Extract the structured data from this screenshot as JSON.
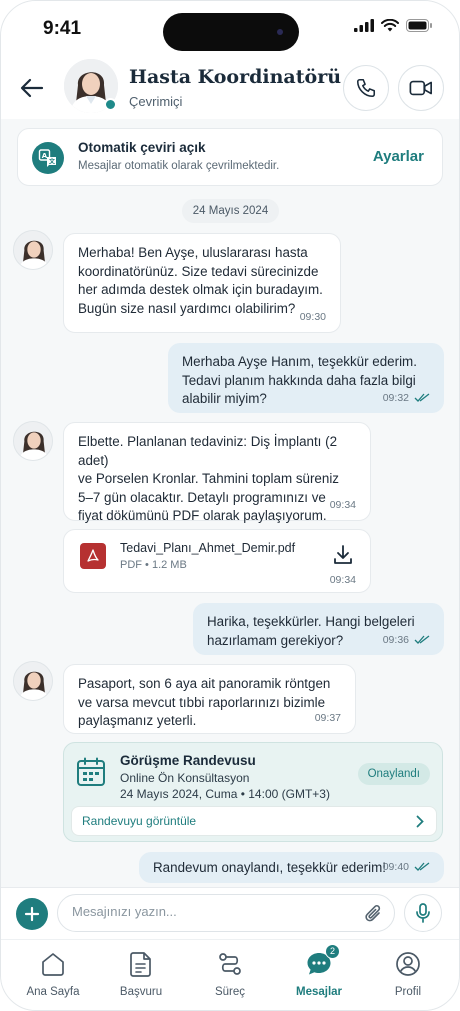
{
  "status_bar": {
    "time": "9:41"
  },
  "header": {
    "title": "Hasta Koordinatörü",
    "status": "Çevrimiçi",
    "icons": [
      "back-arrow-icon",
      "phone-icon",
      "video-camera-icon"
    ]
  },
  "translate_banner": {
    "title": "Otomatik çeviri açık",
    "subtitle": "Mesajlar otomatik olarak çevrilmektedir.",
    "action": "Ayarlar"
  },
  "chat": {
    "date": "24 Mayıs 2024",
    "messages": [
      {
        "from": "agent",
        "lines": [
          "Merhaba! Ben Ayşe, uluslararası hasta",
          "koordinatörünüz. Size tedavi sürecinizde",
          "her adımda destek olmak için buradayım.",
          "Bugün size nasıl yardımcı olabilirim?"
        ],
        "time": "09:30"
      },
      {
        "from": "user",
        "lines": [
          "Merhaba Ayşe Hanım, teşekkür ederim.",
          "Tedavi planım hakkında daha fazla bilgi",
          "alabilir miyim?"
        ],
        "time": "09:32",
        "read": true
      },
      {
        "from": "agent",
        "lines": [
          "Elbette. Planlanan tedaviniz: Diş İmplantı (2 adet)",
          "ve Porselen Kronlar. Tahmini toplam süreniz",
          "5–7 gün olacaktır. Detaylı programınızı ve",
          "fiyat dökümünü PDF olarak paylaşıyorum."
        ],
        "time": "09:34"
      },
      {
        "from": "user",
        "lines": [
          "Harika, teşekkürler. Hangi belgeleri",
          "hazırlamam gerekiyor?"
        ],
        "time": "09:36",
        "read": true
      },
      {
        "from": "agent",
        "lines": [
          "Pasaport, son 6 aya ait panoramik röntgen",
          "ve varsa mevcut tıbbi raporlarınızı bizimle",
          "paylaşmanız yeterli."
        ],
        "time": "09:37"
      },
      {
        "from": "user",
        "lines": [
          "Randevum onaylandı, teşekkür ederim!"
        ],
        "time": "09:40",
        "read": true
      }
    ],
    "attachment": {
      "filename": "Tedavi_Planı_Ahmet_Demir.pdf",
      "meta": "PDF • 1.2 MB",
      "time": "09:34"
    },
    "appointment": {
      "title": "Görüşme Randevusu",
      "type": "Online Ön Konsültasyon",
      "datetime": "24 Mayıs 2024, Cuma  •  14:00 (GMT+3)",
      "status": "Onaylandı",
      "link": "Randevuyu görüntüle"
    }
  },
  "composer": {
    "placeholder": "Mesajınızı yazın..."
  },
  "tabs": [
    {
      "label": "Ana Sayfa",
      "icon": "home-icon"
    },
    {
      "label": "Başvuru",
      "icon": "document-icon"
    },
    {
      "label": "Süreç",
      "icon": "process-icon"
    },
    {
      "label": "Mesajlar",
      "icon": "chat-icon",
      "active": true,
      "badge": "2"
    },
    {
      "label": "Profil",
      "icon": "profile-icon"
    }
  ],
  "colors": {
    "accent": "#1f7d7e",
    "outgoing_bubble": "#e3eef5",
    "appointment_bg": "#e8f3f2",
    "pdf_red": "#b63131"
  }
}
